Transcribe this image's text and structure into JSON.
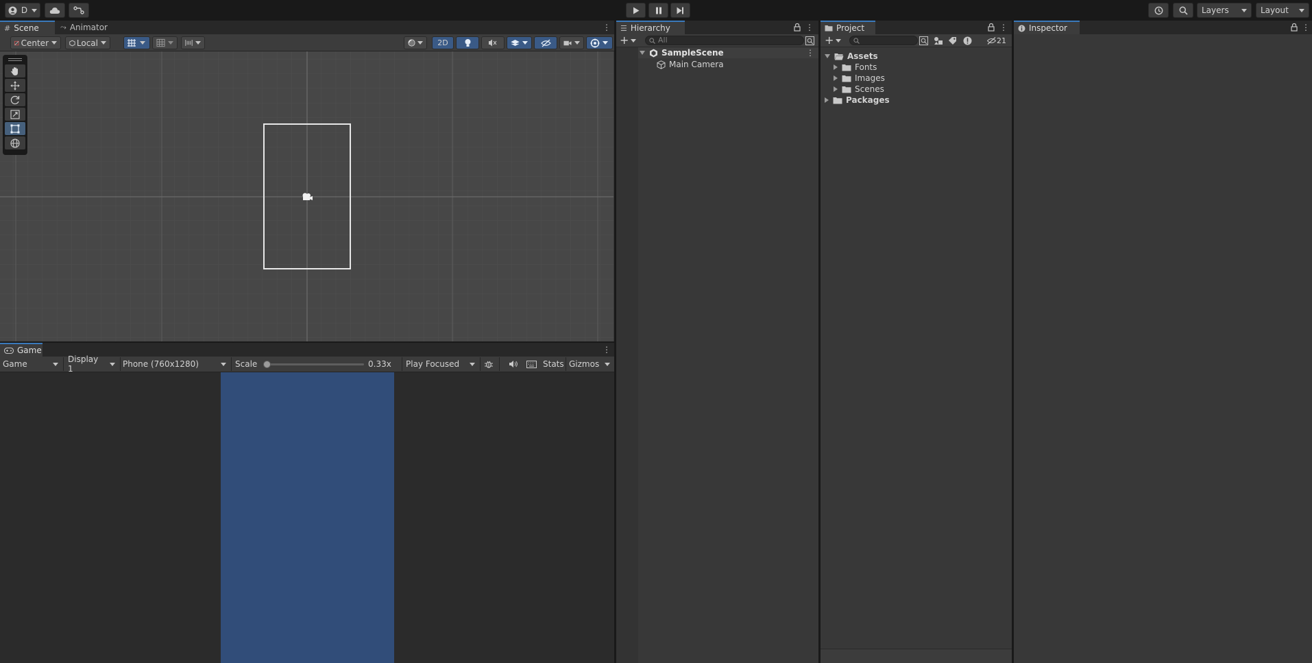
{
  "toolbar": {
    "account_label": "D",
    "layers_label": "Layers",
    "layout_label": "Layout"
  },
  "scene_panel": {
    "tabs": [
      {
        "label": "Scene"
      },
      {
        "label": "Animator"
      }
    ],
    "pivot_label": "Center",
    "space_label": "Local",
    "mode_2d_label": "2D"
  },
  "game_panel": {
    "tab_label": "Game",
    "view_select": "Game",
    "display_select": "Display 1",
    "resolution_select": "Phone (760x1280)",
    "scale_label": "Scale",
    "scale_value": "0.33x",
    "scale_slider_fraction": 0,
    "play_mode_select": "Play Focused",
    "stats_label": "Stats",
    "gizmos_label": "Gizmos",
    "camera_background_color": "#314D79"
  },
  "hierarchy": {
    "tab_label": "Hierarchy",
    "search_placeholder": "All",
    "scene_name": "SampleScene",
    "objects": [
      {
        "label": "Main Camera"
      }
    ]
  },
  "project": {
    "tab_label": "Project",
    "hidden_count": "21",
    "tree": [
      {
        "label": "Assets",
        "bold": true,
        "expanded": true
      },
      {
        "label": "Fonts",
        "bold": false
      },
      {
        "label": "Images",
        "bold": false
      },
      {
        "label": "Scenes",
        "bold": false
      },
      {
        "label": "Packages",
        "bold": true,
        "expanded": false
      }
    ]
  },
  "inspector": {
    "tab_label": "Inspector"
  },
  "colors": {
    "accent": "#3A79BB",
    "panel_bg": "#383838",
    "scene_bg": "#474747"
  }
}
